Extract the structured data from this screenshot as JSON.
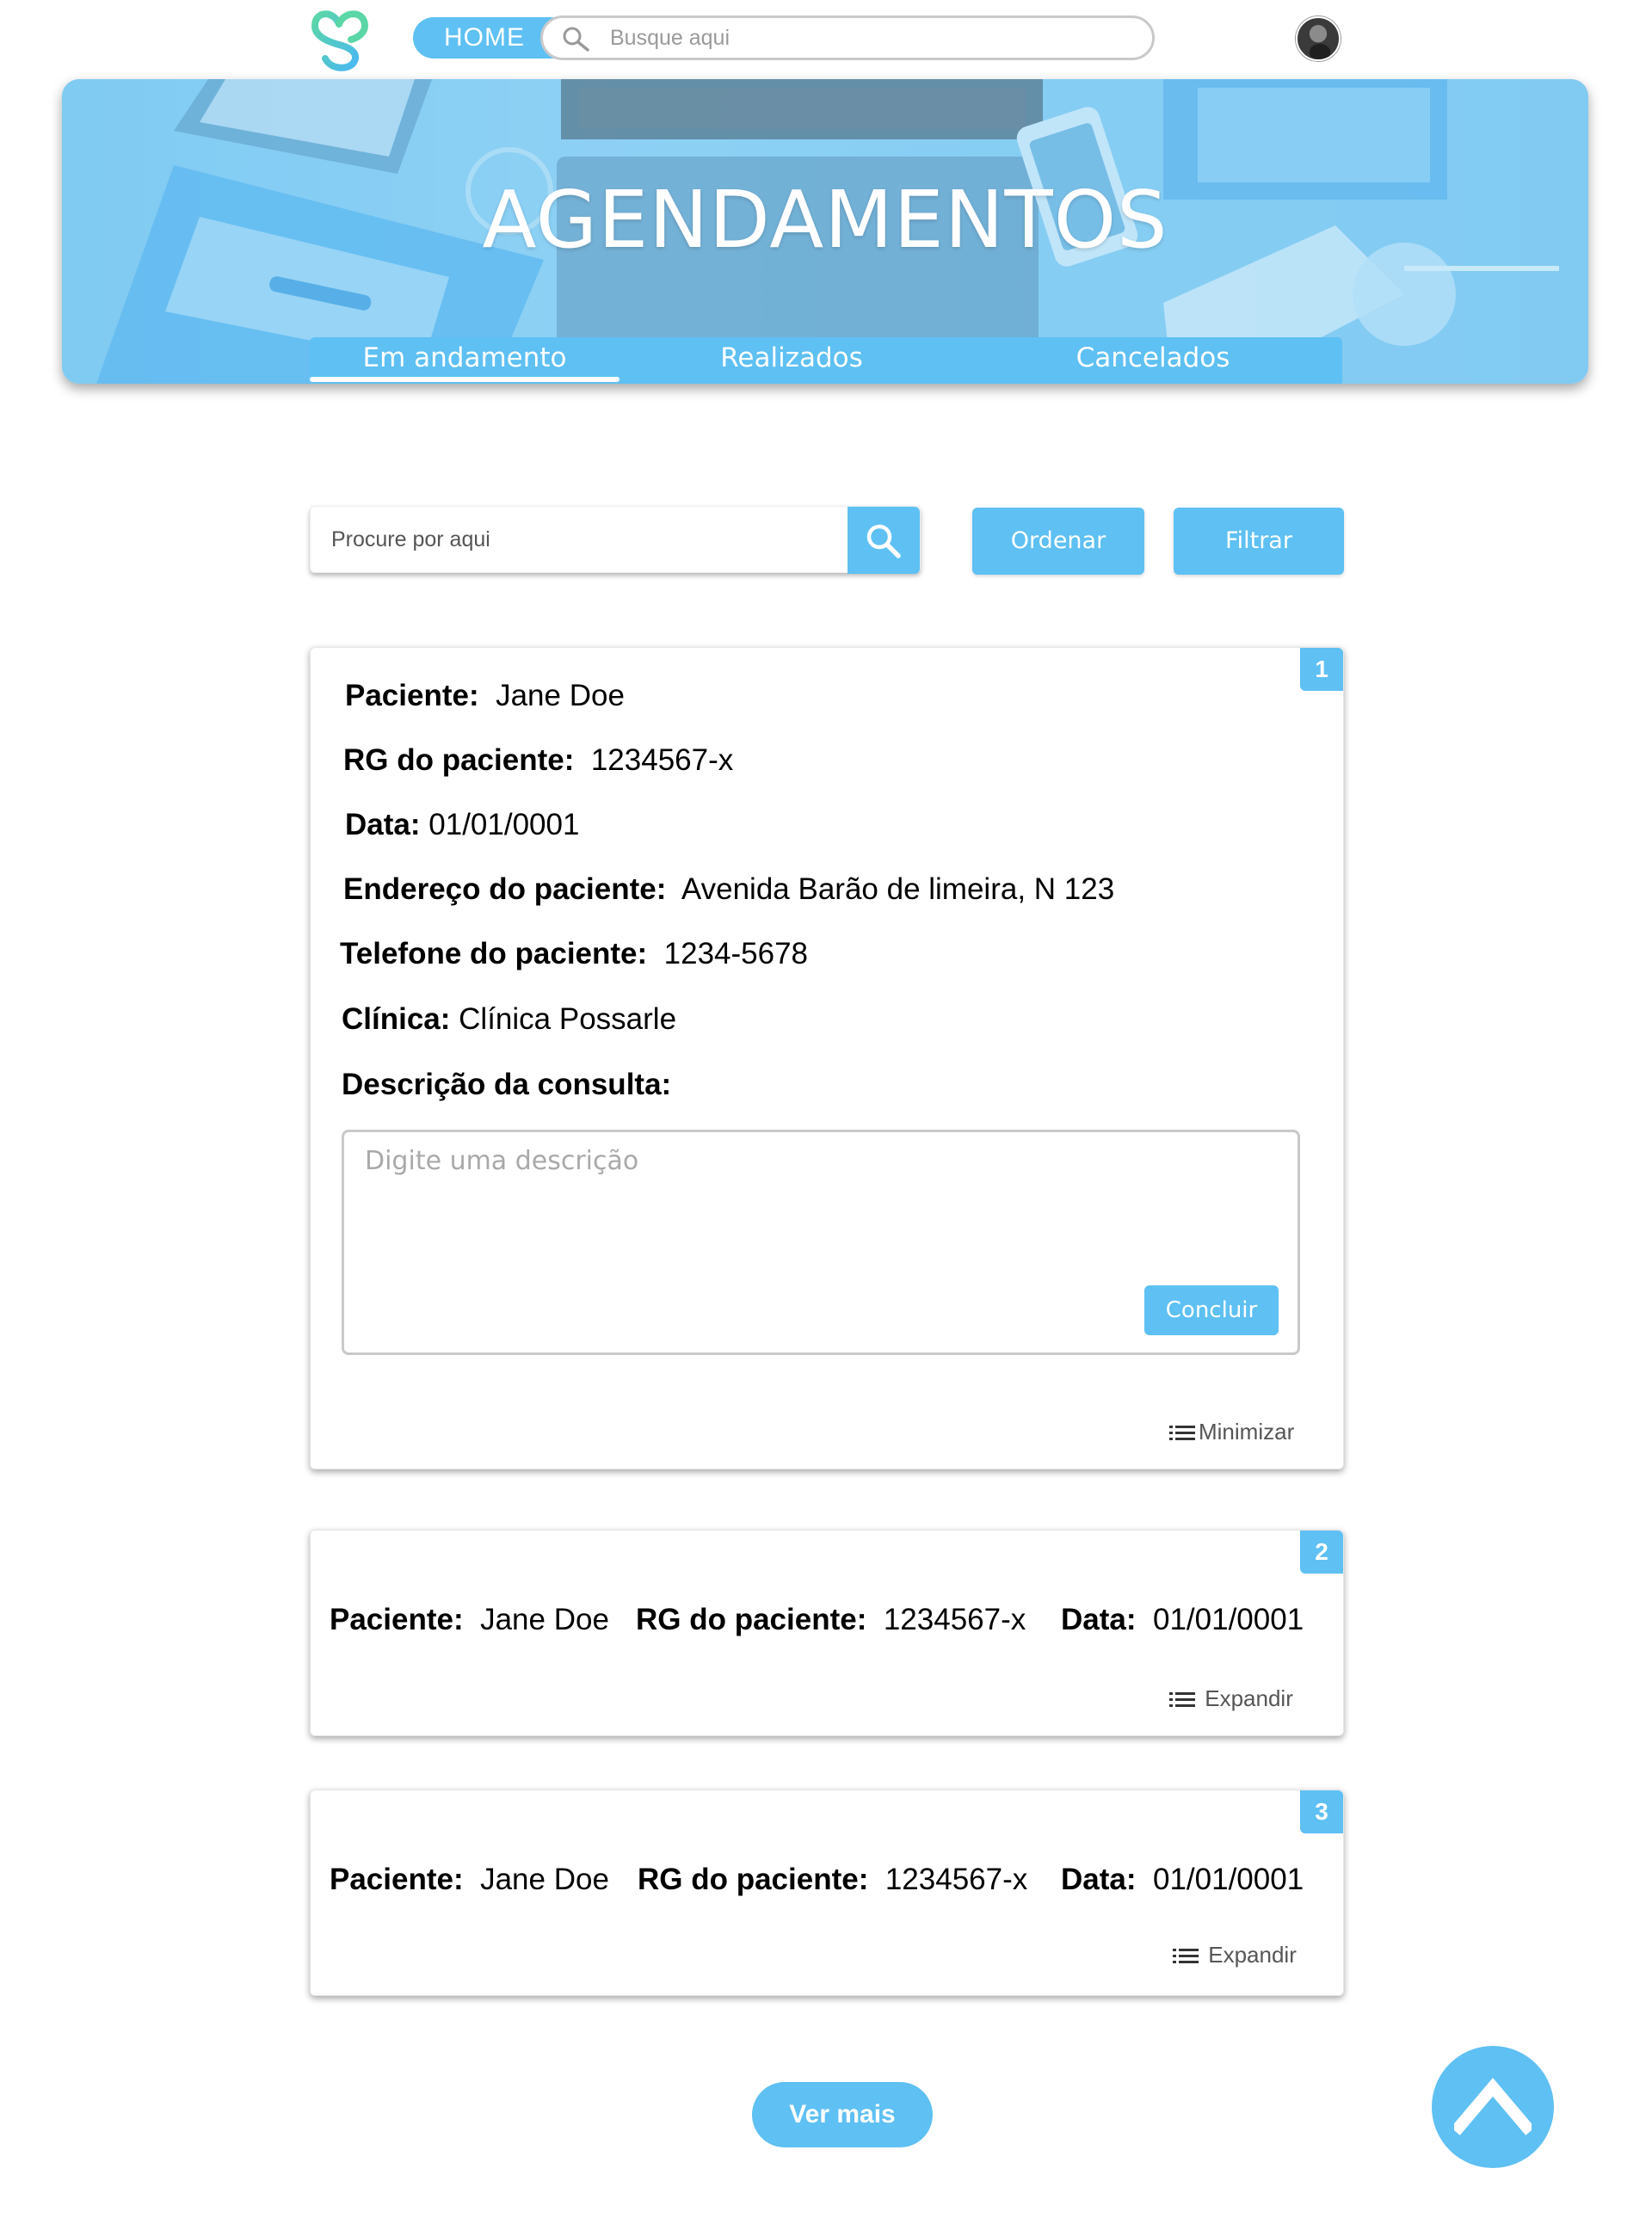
{
  "header": {
    "home_label": "HOME",
    "search_placeholder": "Busque aqui"
  },
  "banner": {
    "title": "AGENDAMENTOS",
    "tabs": [
      {
        "label": "Em andamento",
        "active": true
      },
      {
        "label": "Realizados",
        "active": false
      },
      {
        "label": "Cancelados",
        "active": false
      }
    ]
  },
  "toolbar": {
    "search_placeholder": "Procure por aqui",
    "order_label": "Ordenar",
    "filter_label": "Filtrar"
  },
  "cards": [
    {
      "number": "1",
      "expanded": true,
      "patient_label": "Paciente:",
      "patient": "Jane Doe",
      "rg_label": "RG do paciente:",
      "rg": "1234567-x",
      "date_label": "Data:",
      "date": "01/01/0001",
      "address_label": "Endereço do paciente:",
      "address": "Avenida Barão de limeira, N 123",
      "phone_label": "Telefone do paciente:",
      "phone": "1234-5678",
      "clinic_label": "Clínica:",
      "clinic": "Clínica Possarle",
      "description_label": "Descrição da consulta:",
      "description_placeholder": "Digite uma descrição",
      "conclude_label": "Concluir",
      "toggle_label": "Minimizar"
    },
    {
      "number": "2",
      "expanded": false,
      "patient_label": "Paciente:",
      "patient": "Jane Doe",
      "rg_label": "RG do paciente:",
      "rg": "1234567-x",
      "date_label": "Data:",
      "date": "01/01/0001",
      "toggle_label": "Expandir"
    },
    {
      "number": "3",
      "expanded": false,
      "patient_label": "Paciente:",
      "patient": "Jane Doe",
      "rg_label": "RG do paciente:",
      "rg": "1234567-x",
      "date_label": "Data:",
      "date": "01/01/0001",
      "toggle_label": "Expandir"
    }
  ],
  "footer": {
    "more_label": "Ver mais"
  },
  "colors": {
    "accent": "#5ec0f3",
    "banner_tint": "#86cdf3"
  },
  "icons": {
    "logo": "heart-s-logo-icon",
    "search": "search-icon",
    "list": "list-icon",
    "scroll_top": "chevron-up-icon"
  }
}
